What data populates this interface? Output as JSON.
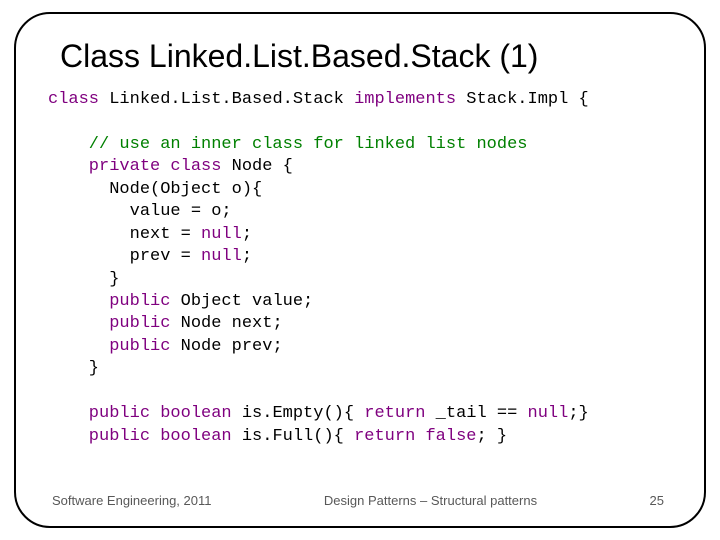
{
  "title": "Class Linked.List.Based.Stack (1)",
  "code": {
    "l1a": "class",
    "l1b": " Linked.List.Based.Stack ",
    "l1c": "implements",
    "l1d": " Stack.Impl {",
    "l2": "",
    "l3": "    // use an inner class for linked list nodes",
    "l4a": "    private class",
    "l4b": " Node {",
    "l5": "      Node(Object o){",
    "l6": "        value = o;",
    "l7a": "        next = ",
    "l7b": "null",
    "l7c": ";",
    "l8a": "        prev = ",
    "l8b": "null",
    "l8c": ";",
    "l9": "      }",
    "l10a": "      public",
    "l10b": " Object value;",
    "l11a": "      public",
    "l11b": " Node next;",
    "l12a": "      public",
    "l12b": " Node prev;",
    "l13": "    }",
    "l14": "",
    "l15a": "    public boolean",
    "l15b": " is.Empty(){ ",
    "l15c": "return",
    "l15d": " _tail == ",
    "l15e": "null",
    "l15f": ";}",
    "l16a": "    public boolean",
    "l16b": " is.Full(){ ",
    "l16c": "return false",
    "l16d": "; }"
  },
  "footer": {
    "left": "Software Engineering, 2011",
    "center": "Design Patterns – Structural patterns",
    "right": "25"
  }
}
